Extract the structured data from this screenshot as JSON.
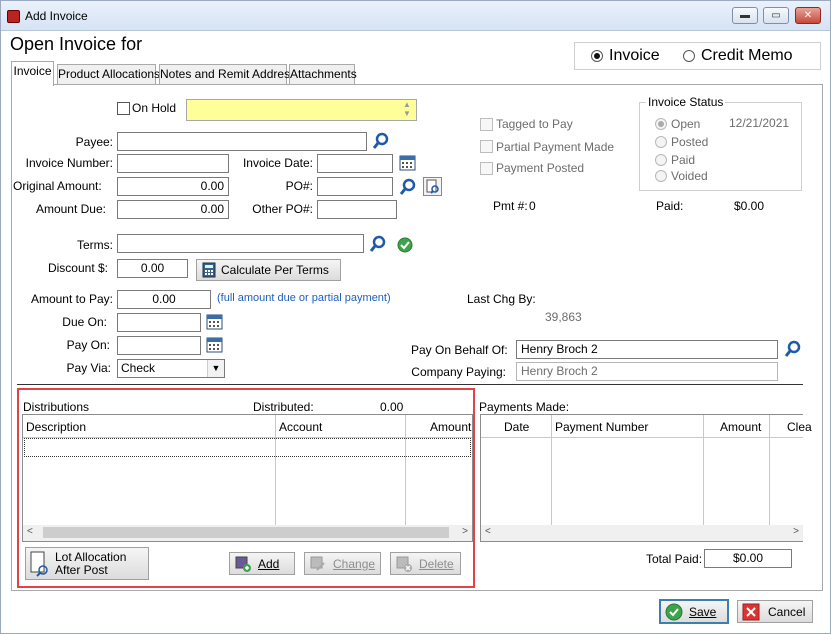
{
  "window": {
    "title": "Add Invoice",
    "min": "▬",
    "max": "▭",
    "close": "✕"
  },
  "header": {
    "title": "Open Invoice for"
  },
  "doc_type": {
    "invoice": "Invoice",
    "credit_memo": "Credit Memo",
    "selected": "Invoice"
  },
  "tabs": [
    {
      "label": "Invoice"
    },
    {
      "label": "Product Allocations"
    },
    {
      "label": "Notes and Remit Address"
    },
    {
      "label": "Attachments"
    }
  ],
  "form": {
    "on_hold": "On Hold",
    "payee_label": "Payee:",
    "payee": "",
    "invoice_number_label": "Invoice Number:",
    "invoice_number": "",
    "invoice_date_label": "Invoice Date:",
    "invoice_date": "",
    "original_amount_label": "Original Amount:",
    "original_amount": "0.00",
    "po_label": "PO#:",
    "po": "",
    "amount_due_label": "Amount Due:",
    "amount_due": "0.00",
    "other_po_label": "Other PO#:",
    "other_po": "",
    "terms_label": "Terms:",
    "terms": "",
    "discount_label": "Discount $:",
    "discount": "0.00",
    "calc_terms": "Calculate Per Terms",
    "amount_to_pay_label": "Amount to Pay:",
    "amount_to_pay": "0.00",
    "amount_hint": "(full amount due or partial payment)",
    "due_on_label": "Due On:",
    "pay_on_label": "Pay On:",
    "pay_via_label": "Pay Via:",
    "pay_via": "Check"
  },
  "flags": {
    "tagged": "Tagged to Pay",
    "partial": "Partial Payment Made",
    "posted": "Payment Posted",
    "pmt_label": "Pmt #:",
    "pmt": "0",
    "paid_label": "Paid:",
    "paid": "$0.00"
  },
  "status": {
    "title": "Invoice Status",
    "open": "Open",
    "posted": "Posted",
    "paid": "Paid",
    "voided": "Voided",
    "date": "12/21/2021"
  },
  "last_change": {
    "label": "Last Chg By:",
    "value": "39,863"
  },
  "pay_behalf": {
    "label": "Pay On Behalf Of:",
    "value": "Henry Broch 2",
    "company_label": "Company Paying:",
    "company": "Henry Broch 2"
  },
  "distributions": {
    "title": "Distributions",
    "distributed_label": "Distributed:",
    "distributed": "0.00",
    "columns": [
      "Description",
      "Account",
      "Amount"
    ],
    "lot_allocation": "Lot Allocation\nAfter Post",
    "lot_line1": "Lot Allocation",
    "lot_line2": "After Post",
    "add": "Add",
    "change": "Change",
    "delete": "Delete"
  },
  "payments": {
    "title": "Payments Made:",
    "columns": [
      "Date",
      "Payment Number",
      "Amount",
      "Clea"
    ],
    "total_label": "Total Paid:",
    "total": "$0.00"
  },
  "footer": {
    "save": "Save",
    "cancel": "Cancel"
  },
  "colors": {
    "note_bg": "#ffff99",
    "highlight": "#e3424a",
    "hint": "#1f5fbf"
  }
}
